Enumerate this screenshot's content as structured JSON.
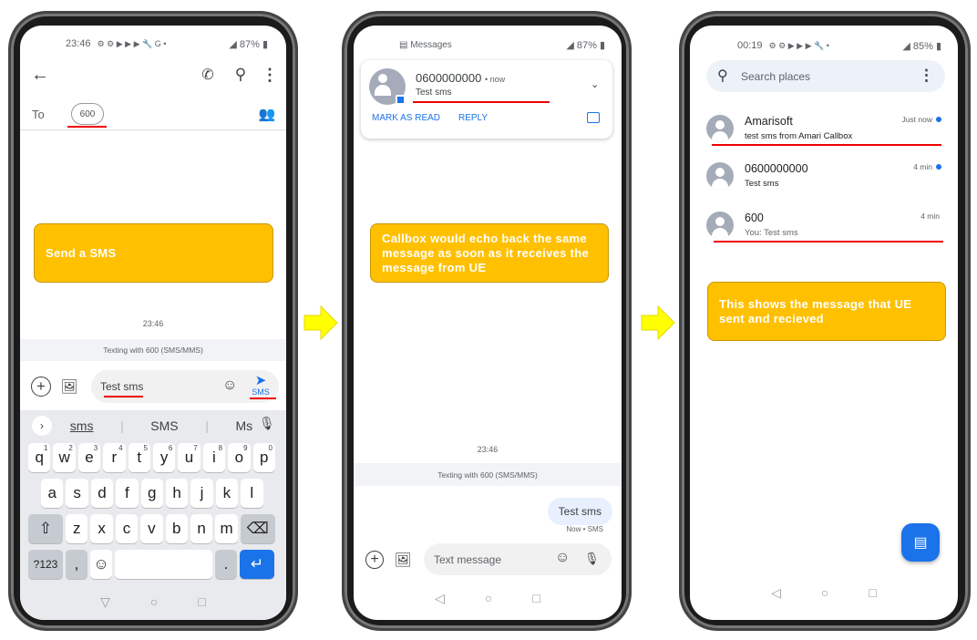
{
  "phone1": {
    "status": {
      "time": "23:46",
      "icons": "⚙ ⚙ ▶ ▶ ▶ 🔧 G •",
      "battery": "87%"
    },
    "toolbar": {
      "back_icon": "arrow-left",
      "call_icon": "phone",
      "search_icon": "search",
      "more_icon": "more-vertical"
    },
    "to_label": "To",
    "recipient": "600",
    "callout": "Send a SMS",
    "timestamp": "23:46",
    "texting_with": "Texting with 600 (SMS/MMS)",
    "compose": {
      "value": "Test sms",
      "send_label": "SMS"
    },
    "suggestions": [
      "sms",
      "SMS",
      "Ms"
    ],
    "keyboard": {
      "row1": [
        {
          "k": "q",
          "n": "1"
        },
        {
          "k": "w",
          "n": "2"
        },
        {
          "k": "e",
          "n": "3"
        },
        {
          "k": "r",
          "n": "4"
        },
        {
          "k": "t",
          "n": "5"
        },
        {
          "k": "y",
          "n": "6"
        },
        {
          "k": "u",
          "n": "7"
        },
        {
          "k": "i",
          "n": "8"
        },
        {
          "k": "o",
          "n": "9"
        },
        {
          "k": "p",
          "n": "0"
        }
      ],
      "row2": [
        "a",
        "s",
        "d",
        "f",
        "g",
        "h",
        "j",
        "k",
        "l"
      ],
      "row3": [
        "z",
        "x",
        "c",
        "v",
        "b",
        "n",
        "m"
      ],
      "symbols": "?123",
      "comma": ",",
      "period": "."
    }
  },
  "phone2": {
    "status": {
      "app": "Messages",
      "battery": "87%"
    },
    "notification": {
      "sender": "0600000000",
      "time": "now",
      "message": "Test sms",
      "mark_read": "MARK AS READ",
      "reply": "REPLY"
    },
    "callout": "Callbox would echo back the same message as soon as it receives the message from UE",
    "timestamp": "23:46",
    "texting_with": "Texting with 600 (SMS/MMS)",
    "bubble": {
      "text": "Test sms",
      "meta": "Now • SMS"
    },
    "compose": {
      "placeholder": "Text message"
    }
  },
  "phone3": {
    "status": {
      "time": "00:19",
      "icons": "⚙ ⚙ ▶ ▶ ▶ 🔧 •",
      "battery": "85%"
    },
    "search": {
      "placeholder": "Search places"
    },
    "conversations": [
      {
        "name": "Amarisoft",
        "snippet": "test sms from Amari Callbox",
        "time": "Just now",
        "unread": true
      },
      {
        "name": "0600000000",
        "snippet": "Test sms",
        "time": "4 min",
        "unread": true
      },
      {
        "name": "600",
        "snippet": "You: Test sms",
        "time": "4 min",
        "unread": false
      }
    ],
    "callout": "This shows the message that UE sent and recieved"
  },
  "colors": {
    "callout": "#FFC000",
    "accent": "#1A73E8",
    "highlight": "#E00000",
    "arrow": "#FFFF00"
  }
}
